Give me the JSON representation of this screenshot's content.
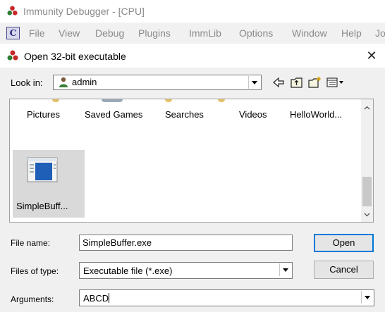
{
  "app": {
    "title": "Immunity Debugger - [CPU]",
    "menu_icon_letter": "C",
    "menu": [
      "File",
      "View",
      "Debug",
      "Plugins",
      "ImmLib",
      "Options",
      "Window",
      "Help",
      "Jo"
    ]
  },
  "dialog": {
    "title": "Open 32-bit executable",
    "close_glyph": "✕",
    "look_in": {
      "label": "Look in:",
      "value": "admin"
    },
    "folders": [
      "Pictures",
      "Saved Games",
      "Searches",
      "Videos",
      "HelloWorld..."
    ],
    "file": {
      "name": "SimpleBuff..."
    },
    "file_name": {
      "label": "File name:",
      "value": "SimpleBuffer.exe"
    },
    "file_type": {
      "label": "Files of type:",
      "value": "Executable file (*.exe)"
    },
    "arguments": {
      "label": "Arguments:",
      "value": "ABCD"
    },
    "open_button": "Open",
    "cancel_button": "Cancel"
  },
  "icons": [
    "immunity-logo-icon",
    "user-folder-icon",
    "back-arrow-icon",
    "up-folder-icon",
    "new-folder-icon",
    "view-menu-icon",
    "executable-file-icon",
    "close-icon"
  ],
  "colors": {
    "selection": "#d9d9d9",
    "accent": "#0078d7",
    "dialog_bg": "#f0f0f0"
  }
}
